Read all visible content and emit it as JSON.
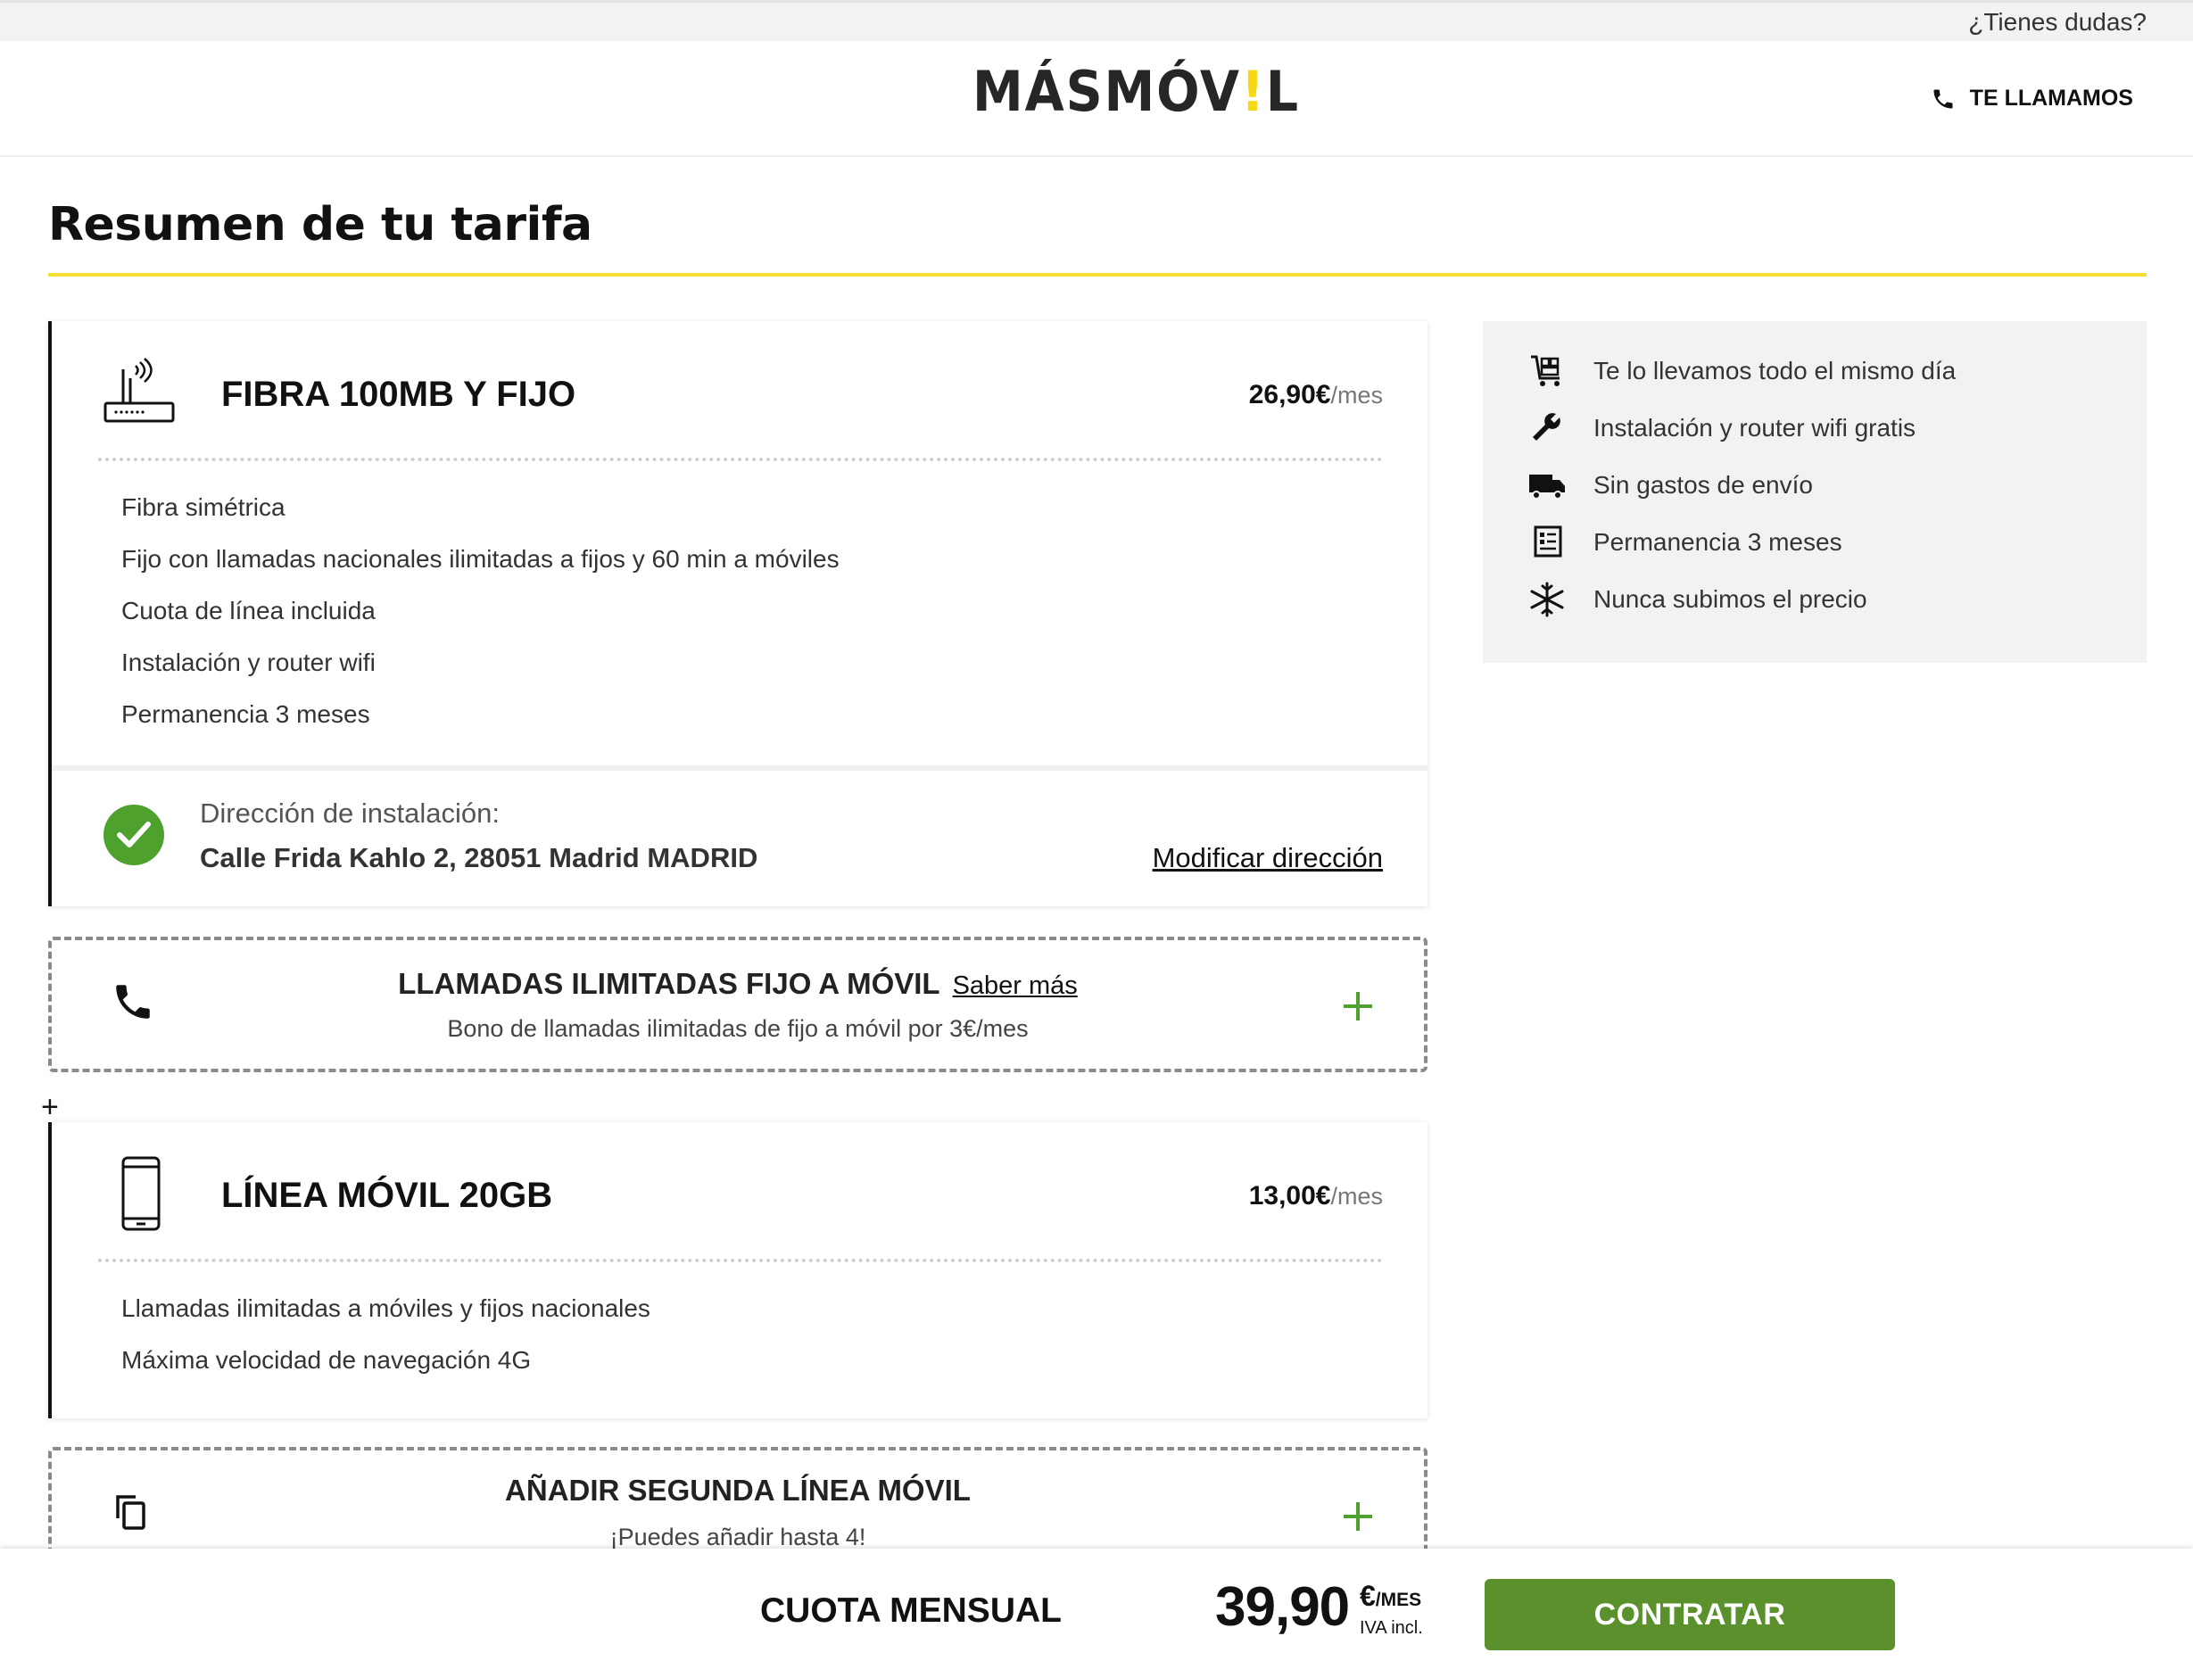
{
  "topbar": {
    "doubts": "¿Tienes dudas?"
  },
  "header": {
    "logo_text": "MÁSMÓV",
    "logo_bang": "!",
    "logo_end": "L",
    "callback_label": "TE LLAMAMOS"
  },
  "page": {
    "title": "Resumen de tu tarifa"
  },
  "fiber_card": {
    "title": "FIBRA 100MB Y FIJO",
    "price": "26,90€",
    "price_unit": "/mes",
    "features": [
      "Fibra simétrica",
      "Fijo con llamadas nacionales ilimitadas a fijos y 60 min a móviles",
      "Cuota de línea incluida",
      "Instalación y router wifi",
      "Permanencia 3 meses"
    ],
    "address_label": "Dirección de instalación:",
    "address_value": "Calle Frida Kahlo 2, 28051 Madrid MADRID",
    "modify_link": "Modificar dirección"
  },
  "calls_addon": {
    "title": "LLAMADAS ILIMITADAS FIJO A MÓVIL",
    "more_link": "Saber más",
    "subtitle": "Bono de llamadas ilimitadas de fijo a móvil por 3€/mes"
  },
  "separator": "+",
  "mobile_card": {
    "title": "LÍNEA MÓVIL 20GB",
    "price": "13,00€",
    "price_unit": "/mes",
    "features": [
      "Llamadas ilimitadas a móviles y fijos nacionales",
      "Máxima velocidad de navegación 4G"
    ]
  },
  "second_line_addon": {
    "title": "AÑADIR SEGUNDA LÍNEA MÓVIL",
    "subtitle": "¡Puedes añadir hasta 4!"
  },
  "benefits": [
    {
      "icon": "cart-icon",
      "text": "Te lo llevamos todo el mismo día"
    },
    {
      "icon": "wrench-icon",
      "text": "Instalación y router wifi gratis"
    },
    {
      "icon": "truck-icon",
      "text": "Sin gastos de envío"
    },
    {
      "icon": "contract-icon",
      "text": "Permanencia 3 meses"
    },
    {
      "icon": "snowflake-icon",
      "text": "Nunca subimos el precio"
    }
  ],
  "bottom": {
    "label": "CUOTA MENSUAL",
    "price": "39,90",
    "currency": "€",
    "per": "/MES",
    "iva": "IVA incl.",
    "cta": "CONTRATAR"
  },
  "colors": {
    "accent_yellow": "#f6df33",
    "cta_green": "#5a912c",
    "check_green": "#4fa12e",
    "plus_green": "#4fa12e"
  }
}
